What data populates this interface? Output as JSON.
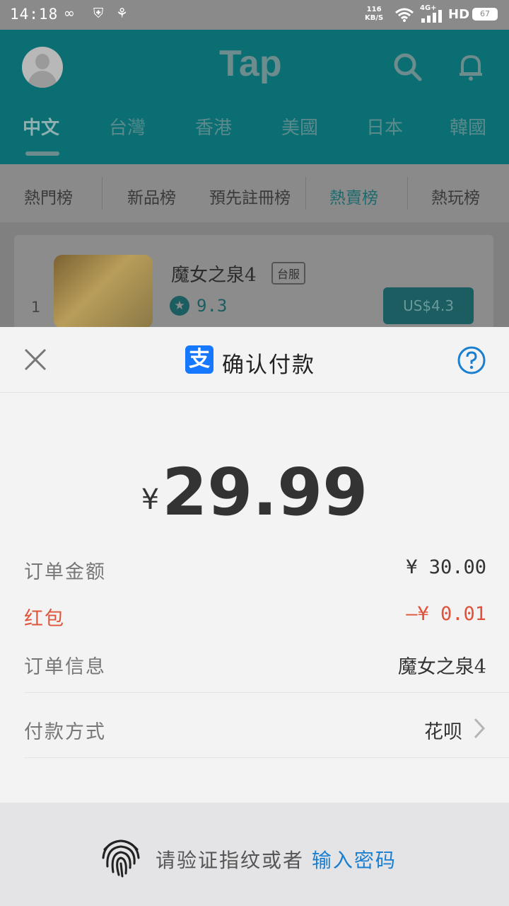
{
  "status_bar": {
    "time": "14:18",
    "net_speed_value": "116",
    "net_speed_unit": "KB/S",
    "network": "4G+",
    "hd": "HD",
    "battery": "67"
  },
  "app": {
    "logo": "Tap",
    "tabs": [
      "中文",
      "台灣",
      "香港",
      "美國",
      "日本",
      "韓國"
    ],
    "active_tab": "中文",
    "rank_tabs": [
      "熱門榜",
      "新品榜",
      "預先註冊榜",
      "熱賣榜",
      "熱玩榜"
    ],
    "active_rank": "熱賣榜"
  },
  "game": {
    "rank": "1",
    "title": "魔女之泉4",
    "tag": "台服",
    "rating": "9.3",
    "price": "US$4.3"
  },
  "payment": {
    "title": "确认付款",
    "logo_glyph": "支",
    "currency": "¥",
    "amount": "29.99",
    "rows": {
      "order_amount_label": "订单金额",
      "order_amount_value": "¥ 30.00",
      "red_packet_label": "红包",
      "red_packet_value": "—¥ 0.01",
      "order_info_label": "订单信息",
      "order_info_value": "魔女之泉4",
      "method_label": "付款方式",
      "method_value": "花呗"
    },
    "fingerprint_text": "请验证指纹或者",
    "password_link": "输入密码"
  }
}
